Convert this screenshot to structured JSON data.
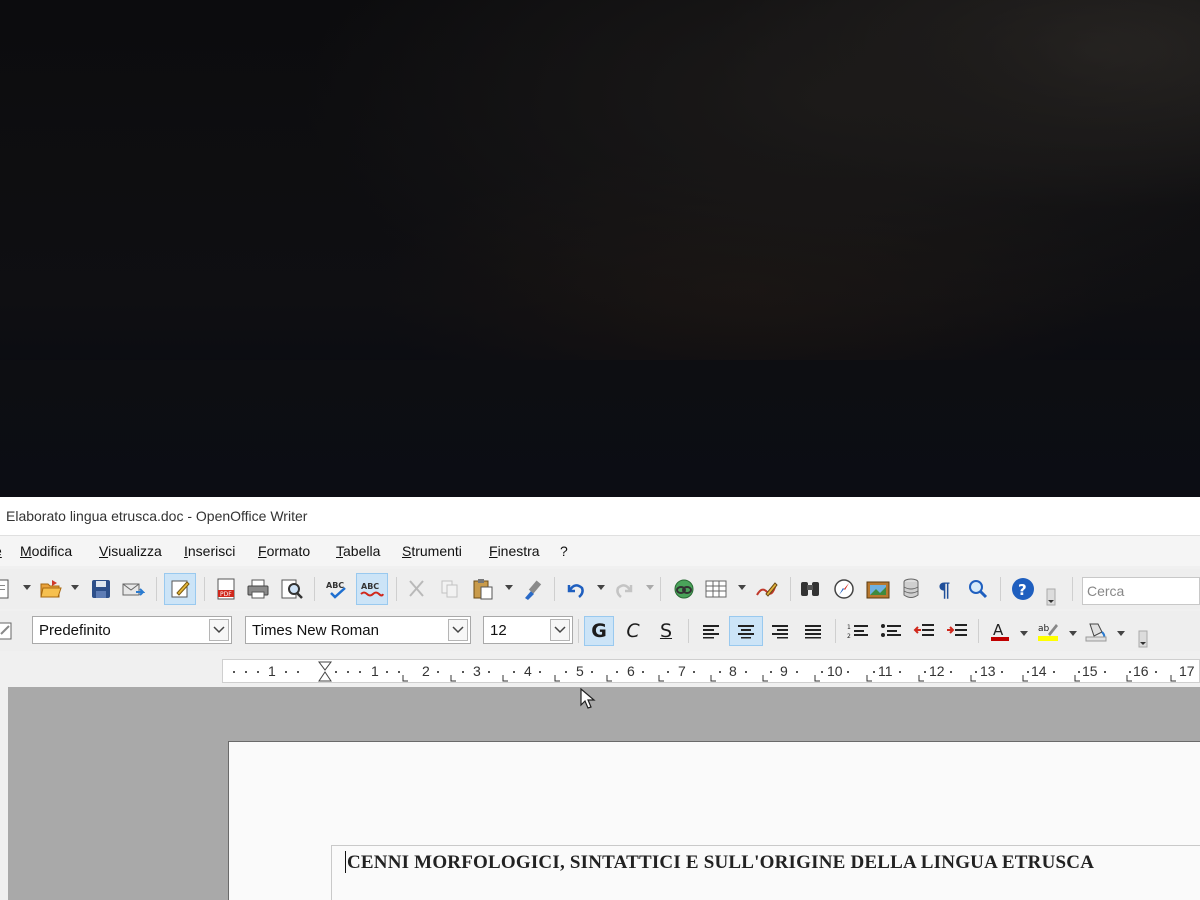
{
  "window": {
    "title": "Elaborato lingua etrusca.doc - OpenOffice Writer"
  },
  "menu": {
    "items": [
      {
        "label": "e"
      },
      {
        "label": "Modifica"
      },
      {
        "label": "Visualizza"
      },
      {
        "label": "Inserisci"
      },
      {
        "label": "Formato"
      },
      {
        "label": "Tabella"
      },
      {
        "label": "Strumenti"
      },
      {
        "label": "Finestra"
      },
      {
        "label": "?"
      }
    ]
  },
  "toolbar": {
    "icons": [
      "new-document-icon",
      "open-folder-icon",
      "save-icon",
      "email-icon",
      "edit-mode-icon",
      "export-pdf-icon",
      "print-icon",
      "print-preview-icon",
      "spellcheck-icon",
      "autospellcheck-icon",
      "cut-icon",
      "copy-icon",
      "paste-icon",
      "format-paintbrush-icon",
      "undo-icon",
      "redo-icon",
      "hyperlink-icon",
      "table-icon",
      "draw-functions-icon",
      "find-replace-icon",
      "navigator-icon",
      "gallery-icon",
      "data-sources-icon",
      "formatting-marks-icon",
      "zoom-icon",
      "help-icon"
    ],
    "search_placeholder": "Cerca"
  },
  "formatting": {
    "style": "Predefinito",
    "font": "Times New Roman",
    "size": "12",
    "bold_label": "G",
    "italic_label": "C",
    "underline_label": "S",
    "alignment": "center"
  },
  "ruler": {
    "labels": [
      "1",
      "1",
      "2",
      "3",
      "4",
      "5",
      "6",
      "7",
      "8",
      "9",
      "10",
      "11",
      "12",
      "13",
      "14",
      "15",
      "16",
      "17"
    ]
  },
  "document": {
    "heading": "CENNI MORFOLOGICI, SINTATTICI E SULL'ORIGINE DELLA LINGUA ETRUSCA"
  },
  "colors": {
    "accent_active": "#cce4f7",
    "font_color_bar": "#c00000",
    "highlight_bar": "#ffff00",
    "help_blue": "#1f5fbf"
  }
}
